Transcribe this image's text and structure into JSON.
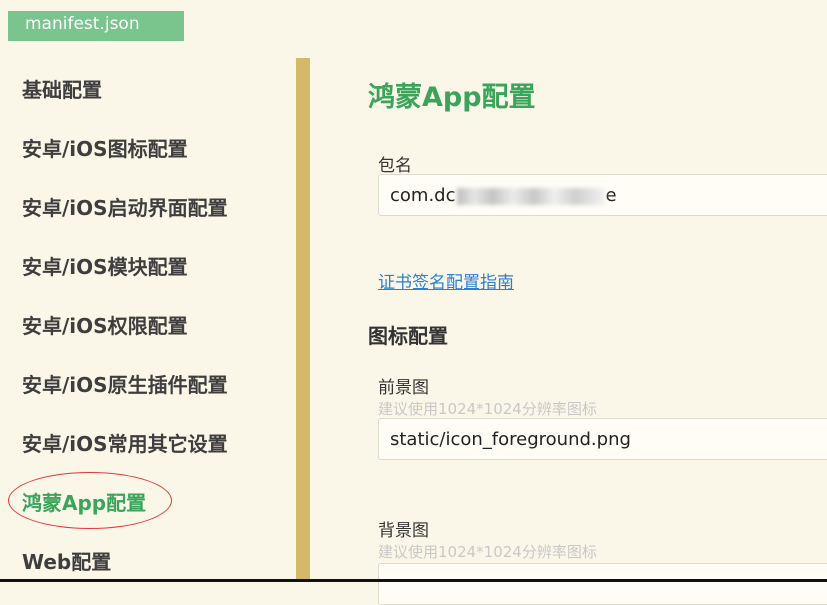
{
  "tab": {
    "label": "manifest.json"
  },
  "sidebar": {
    "items": [
      {
        "label": "基础配置"
      },
      {
        "label": "安卓/iOS图标配置"
      },
      {
        "label": "安卓/iOS启动界面配置"
      },
      {
        "label": "安卓/iOS模块配置"
      },
      {
        "label": "安卓/iOS权限配置"
      },
      {
        "label": "安卓/iOS原生插件配置"
      },
      {
        "label": "安卓/iOS常用其它设置"
      },
      {
        "label": "鸿蒙App配置"
      },
      {
        "label": "Web配置"
      }
    ],
    "active_index": 7
  },
  "main": {
    "title": "鸿蒙App配置",
    "package": {
      "label": "包名",
      "value_prefix": "com.dc",
      "value_suffix": "e"
    },
    "cert_link": "证书签名配置指南",
    "icon_section": "图标配置",
    "foreground": {
      "label": "前景图",
      "hint": "建议使用1024*1024分辨率图标",
      "value": "static/icon_foreground.png"
    },
    "background": {
      "label": "背景图",
      "hint": "建议使用1024*1024分辨率图标"
    }
  },
  "colors": {
    "accent": "#3aa55a",
    "tab": "#7ac48d",
    "divider": "#d4b96a",
    "link": "#2b7fd1",
    "highlight_ring": "#e0393b"
  }
}
